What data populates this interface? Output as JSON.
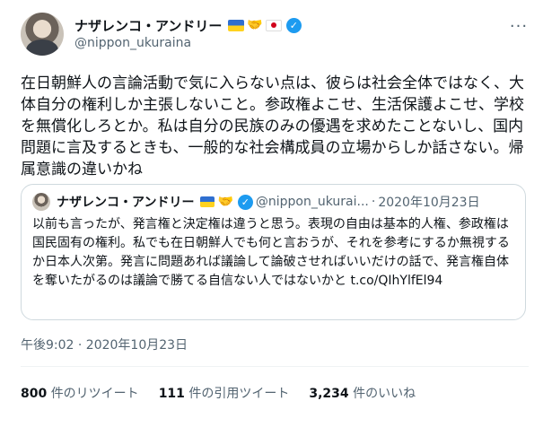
{
  "author": {
    "name": "ナザレンコ・アンドリー",
    "handle": "@nippon_ukuraina",
    "more_label": "···"
  },
  "tweet": {
    "text": "在日朝鮮人の言論活動で気に入らない点は、彼らは社会全体ではなく、大体自分の権利しか主張しないこと。参政権よこせ、生活保護よこせ、学校を無償化しろとか。私は自分の民族のみの優遇を求めたことないし、国内問題に言及するときも、一般的な社会構成員の立場からしか話さない。帰属意識の違いかね",
    "timestamp": "午後9:02 · 2020年10月23日"
  },
  "quote": {
    "name": "ナザレンコ・アンドリー",
    "handle": "@nippon_ukurai...",
    "separator": "·",
    "date": "2020年10月23日",
    "text": "以前も言ったが、発言権と決定権は違うと思う。表現の自由は基本的人権、参政権は国民固有の権利。私でも在日朝鮮人でも何と言おうが、それを参考にするか無視するか日本人次第。発言に問題あれば議論して論破させればいいだけの話で、発言権自体を奪いたがるのは議論で勝てる自信ない人ではないかと t.co/QIhYlfEl94"
  },
  "stats": {
    "retweets_count": "800",
    "retweets_label": "件のリツイート",
    "quotes_count": "111",
    "quotes_label": "件の引用ツイート",
    "likes_count": "3,234",
    "likes_label": "件のいいね"
  },
  "colors": {
    "verified": "#1d9bf0",
    "text": "#0f1419",
    "muted": "#536471",
    "border": "#cfd9de"
  }
}
